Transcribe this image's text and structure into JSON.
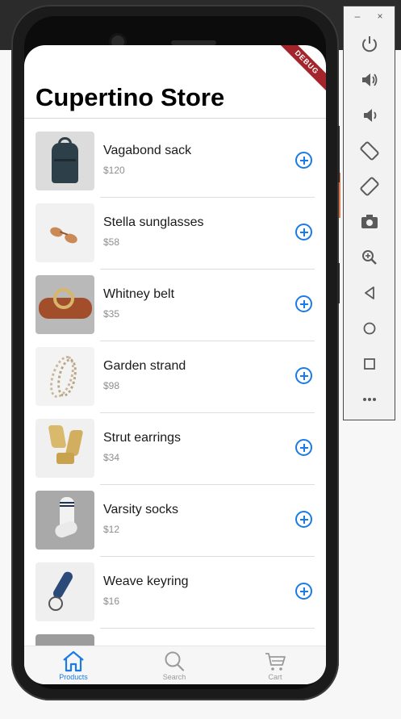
{
  "app": {
    "title": "Cupertino Store",
    "debug_banner": "DEBUG"
  },
  "products": [
    {
      "name": "Vagabond sack",
      "price": "$120",
      "thumb": "sack"
    },
    {
      "name": "Stella sunglasses",
      "price": "$58",
      "thumb": "glasses"
    },
    {
      "name": "Whitney belt",
      "price": "$35",
      "thumb": "belt"
    },
    {
      "name": "Garden strand",
      "price": "$98",
      "thumb": "strand"
    },
    {
      "name": "Strut earrings",
      "price": "$34",
      "thumb": "earrings"
    },
    {
      "name": "Varsity socks",
      "price": "$12",
      "thumb": "socks"
    },
    {
      "name": "Weave keyring",
      "price": "$16",
      "thumb": "keyring"
    }
  ],
  "bottom_nav": {
    "items": [
      {
        "label": "Products",
        "icon": "home-icon",
        "active": true
      },
      {
        "label": "Search",
        "icon": "search-icon",
        "active": false
      },
      {
        "label": "Cart",
        "icon": "cart-icon",
        "active": false
      }
    ]
  },
  "emulator_panel": {
    "window_controls": {
      "minimize": "–",
      "close": "×"
    },
    "buttons": [
      "power-icon",
      "volume-up-icon",
      "volume-down-icon",
      "rotate-left-icon",
      "rotate-right-icon",
      "camera-icon",
      "zoom-icon",
      "back-icon",
      "home-circle-icon",
      "overview-icon",
      "more-icon"
    ]
  },
  "colors": {
    "accent": "#1a7ae6",
    "debug": "#a3242a",
    "inactive": "#9a9a9a"
  }
}
